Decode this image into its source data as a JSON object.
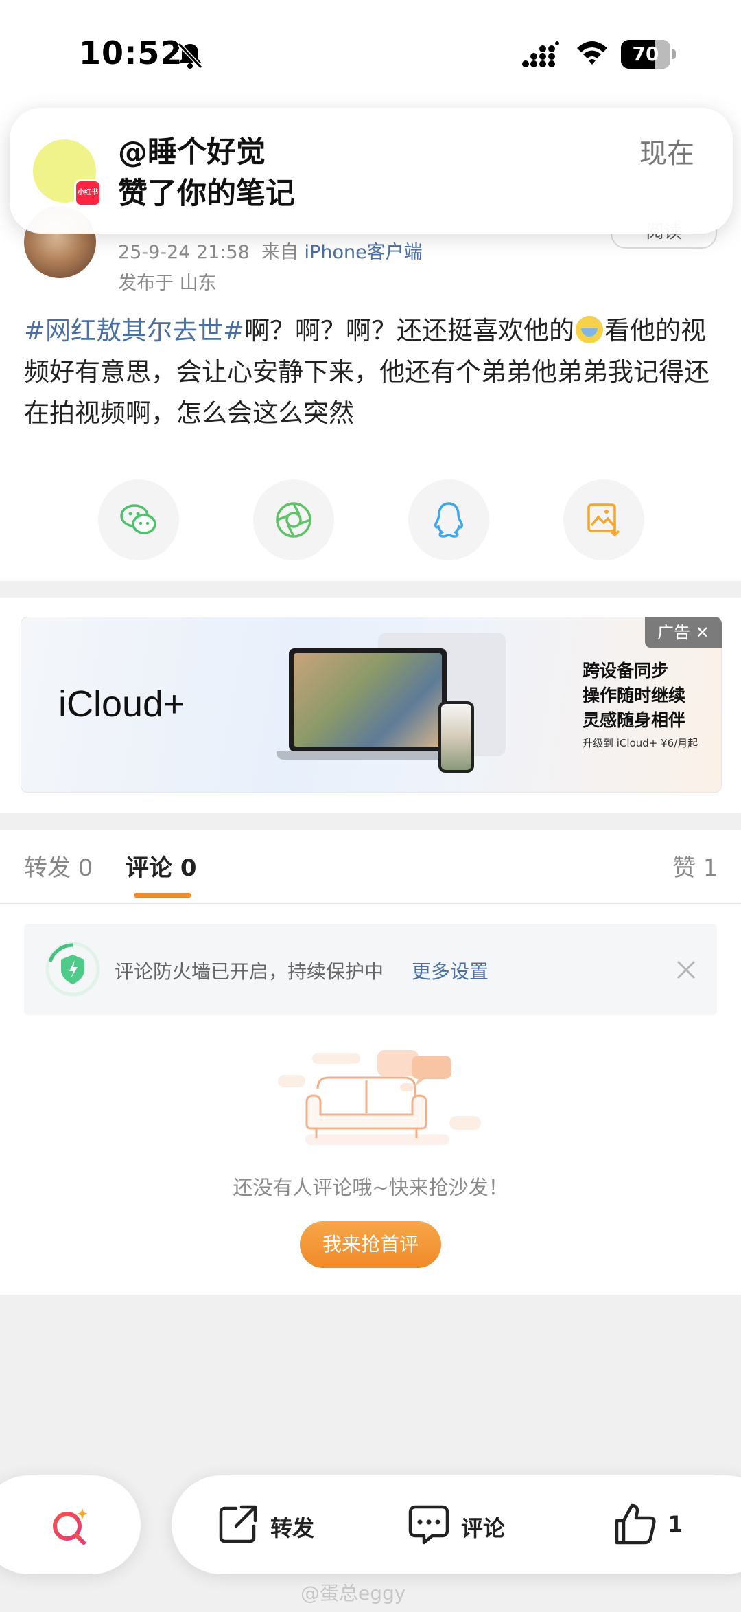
{
  "status_bar": {
    "time": "10:52",
    "battery_percent": 70,
    "battery_label": "70",
    "bell": "bell-slash-icon",
    "signal": "cellular-signal-icon",
    "wifi": "wifi-icon"
  },
  "notification": {
    "title": "@睡个好觉",
    "body": "赞了你的笔记",
    "time": "现在",
    "app_badge": "小红书"
  },
  "post": {
    "meta_time": "25-9-24 21:58",
    "meta_from": "来自",
    "meta_source": "iPhone客户端",
    "location": "发布于 山东",
    "follow_button": "阅读",
    "topic": "#网红敖其尔去世#",
    "text_part1": "啊？啊？啊？还还挺喜欢他的",
    "emoji": "crying-face-emoji",
    "text_part2": "看他的视频好有意思，会让心安静下来，他还有个弟弟他弟弟我记得还在拍视频啊，怎么会这么突然"
  },
  "share": {
    "items": [
      "wechat-icon",
      "moments-icon",
      "qq-icon",
      "save-image-icon"
    ]
  },
  "ad": {
    "brand": "iCloud+",
    "line1": "跨设备同步",
    "line2": "操作随时继续",
    "line3": "灵感随身相伴",
    "small": "升级到 iCloud+ ¥6/月起",
    "tag": "广告 ✕"
  },
  "tabs": {
    "repost": "转发 0",
    "comment_label": "评论",
    "comment_count": "0",
    "like": "赞 1",
    "active": "comment"
  },
  "firewall": {
    "text": "评论防火墙已开启，持续保护中",
    "link": "更多设置"
  },
  "empty_state": {
    "text": "还没有人评论哦~快来抢沙发！",
    "button": "我来抢首评"
  },
  "bottom_bar": {
    "repost": "转发",
    "comment": "评论",
    "like_count": "1"
  },
  "watermark": "@蛋总eggy",
  "colors": {
    "accent": "#f28a2e",
    "link": "#4a6fa5",
    "badge": "#ff2442"
  }
}
